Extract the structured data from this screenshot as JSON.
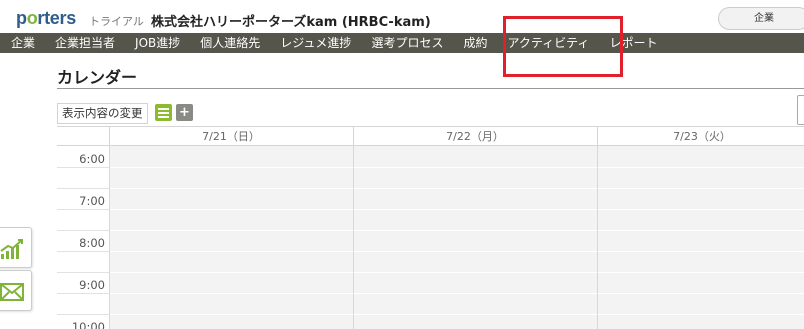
{
  "header": {
    "logo_main": "p",
    "logo_dot": "o",
    "logo_rest": "rters",
    "trial_label": "トライアル",
    "company_name": "株式会社ハリーポーターズkam (HRBC-kam)",
    "company_button": "企業"
  },
  "nav": {
    "items": [
      {
        "label": "企業"
      },
      {
        "label": "企業担当者"
      },
      {
        "label": "JOB進捗"
      },
      {
        "label": "個人連絡先"
      },
      {
        "label": "レジュメ進捗"
      },
      {
        "label": "選考プロセス"
      },
      {
        "label": "成約"
      },
      {
        "label": "アクティビティ"
      },
      {
        "label": "レポート"
      }
    ],
    "highlight_color": "#e2202c"
  },
  "page": {
    "title": "カレンダー"
  },
  "toolbar": {
    "display_change_label": "表示内容の変更",
    "list_icon": "list-icon",
    "add_icon": "plus-icon",
    "list_color": "#8cbc2e",
    "add_color": "#8a8a85"
  },
  "calendar": {
    "days": [
      {
        "label": "7/21（日）"
      },
      {
        "label": "7/22（月）"
      },
      {
        "label": "7/23（火）"
      }
    ],
    "times": [
      "6:00",
      "7:00",
      "8:00",
      "9:00",
      "10:00"
    ]
  },
  "side_buttons": [
    {
      "icon": "chart-icon"
    },
    {
      "icon": "mail-icon"
    }
  ],
  "colors": {
    "navbar": "#55554b",
    "brand_blue": "#2f5e8e",
    "brand_green": "#7fb33a"
  }
}
